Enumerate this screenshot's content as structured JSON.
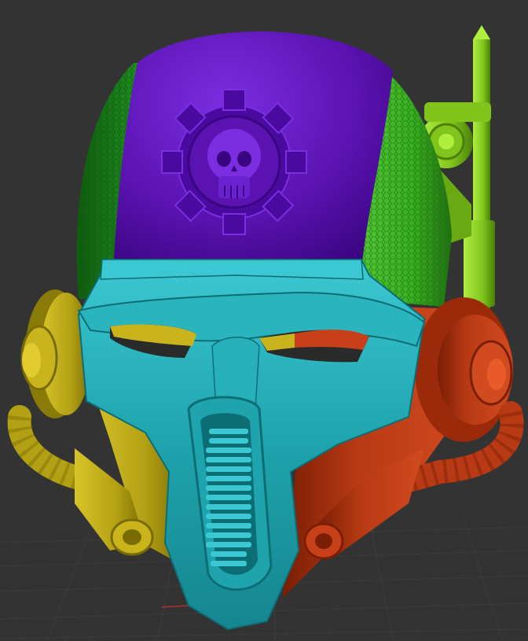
{
  "viewport": {
    "background": "#333333",
    "grid_color": "#3c3c3c",
    "axis_marker_color": "#b03030"
  },
  "model": {
    "polygroups": [
      {
        "name": "crown",
        "color": "#5a12b0",
        "highlight": "#7a2ee0",
        "shade": "#3a0580"
      },
      {
        "name": "left-mesh-panel",
        "color": "#1f8a1f",
        "highlight": "#3cbf3c",
        "shade": "#0f5a0f"
      },
      {
        "name": "right-mesh-panel",
        "color": "#38b020",
        "highlight": "#66d24a",
        "shade": "#1f7010"
      },
      {
        "name": "faceplate",
        "color": "#1fa3ad",
        "highlight": "#4fd6df",
        "shade": "#0d6d75"
      },
      {
        "name": "left-cheek",
        "color": "#b3a014",
        "highlight": "#e0cc30",
        "shade": "#7a6c05"
      },
      {
        "name": "right-cheek",
        "color": "#b83a14",
        "highlight": "#e85a2a",
        "shade": "#7a1e05"
      },
      {
        "name": "antenna",
        "color": "#80c41c",
        "highlight": "#b0ee40",
        "shade": "#4a8008"
      }
    ],
    "emblem_icon": "skull-cog-icon"
  }
}
